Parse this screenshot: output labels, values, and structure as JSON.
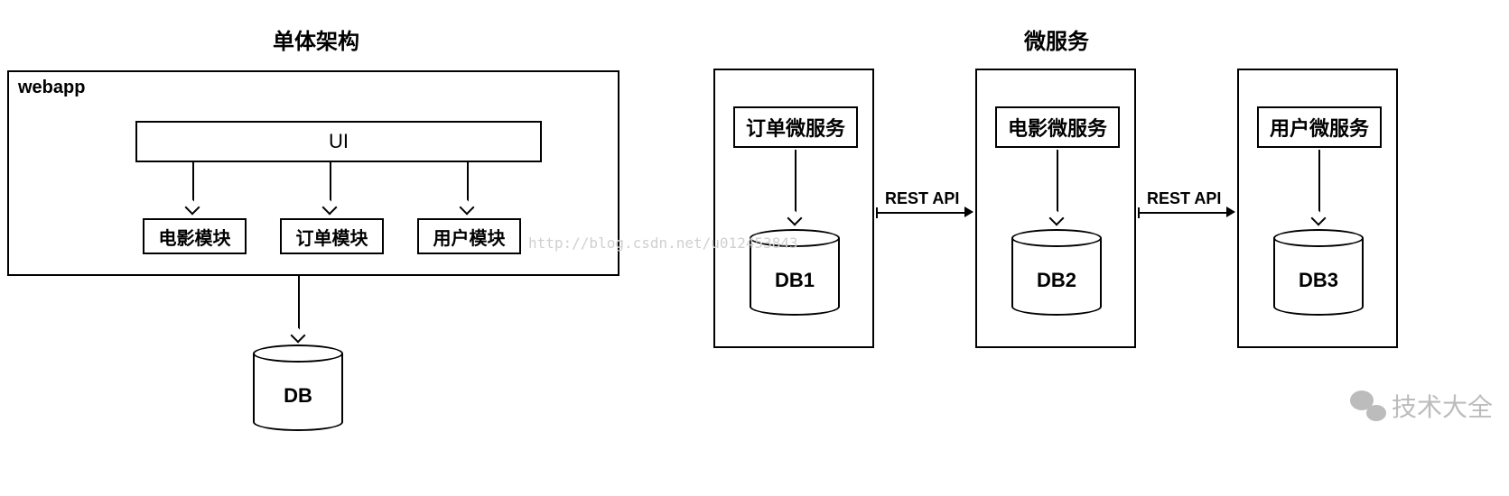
{
  "titles": {
    "monolith": "单体架构",
    "microservice": "微服务"
  },
  "monolith": {
    "container_label": "webapp",
    "ui_label": "UI",
    "modules": [
      "电影模块",
      "订单模块",
      "用户模块"
    ],
    "db_label": "DB"
  },
  "microservices": {
    "services": [
      {
        "name": "订单微服务",
        "db": "DB1"
      },
      {
        "name": "电影微服务",
        "db": "DB2"
      },
      {
        "name": "用户微服务",
        "db": "DB3"
      }
    ],
    "connector_label": "REST API"
  },
  "watermark": {
    "csdn": "http://blog.csdn.net/u012453843",
    "wechat": "技术大全"
  }
}
